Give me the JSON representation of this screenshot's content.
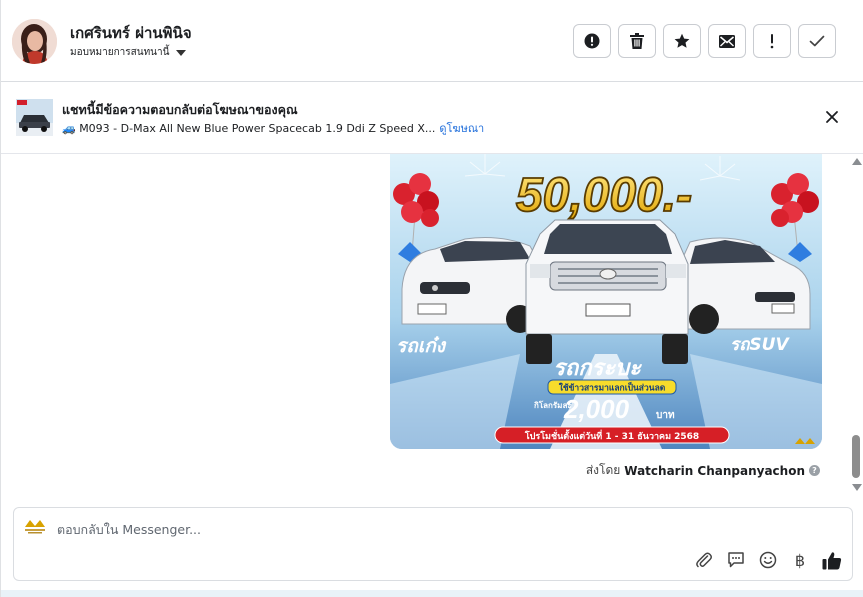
{
  "header": {
    "contact_name": "เกศรินทร์ ผ่านพินิจ",
    "assign_label": "มอบหมายการสนทนานี้",
    "actions": [
      {
        "name": "spam",
        "icon": "alert-circle-icon"
      },
      {
        "name": "delete",
        "icon": "trash-icon"
      },
      {
        "name": "star",
        "icon": "star-icon"
      },
      {
        "name": "mark-unread",
        "icon": "envelope-icon"
      },
      {
        "name": "follow-up",
        "icon": "exclamation-icon"
      },
      {
        "name": "done",
        "icon": "check-icon"
      }
    ]
  },
  "banner": {
    "title": "แชทนี้มีข้อความตอบกลับต่อโฆษณาของคุณ",
    "ad_text": "🚙 M093 - D-Max All New Blue Power Spacecab 1.9 Ddi Z Speed X...",
    "view_ad_link": "ดูโฆษณา"
  },
  "ad_image": {
    "price": "50,000.-",
    "left_label": "รถเก๋ง",
    "right_label": "รถSUV",
    "center_label": "รถกระบะ",
    "yellow_strip": "ใช้ข้าวสารมาแลกเป็นส่วนลด",
    "per_kg": "กิโลกรัมละ",
    "amount": "2,000",
    "unit": "บาท",
    "promo_period": "โปรโมชั่นตั้งแต่วันที่ 1 - 31 ธันวาคม 2568"
  },
  "conversation": {
    "sent_by_prefix": "ส่งโดย",
    "sender_name": "Watcharin Chanpanyachon"
  },
  "composer": {
    "placeholder": "ตอบกลับใน Messenger...",
    "currency_symbol": "฿"
  },
  "colors": {
    "link": "#216fdb",
    "border": "#dadde1",
    "like_icon": "#1c1e21"
  }
}
